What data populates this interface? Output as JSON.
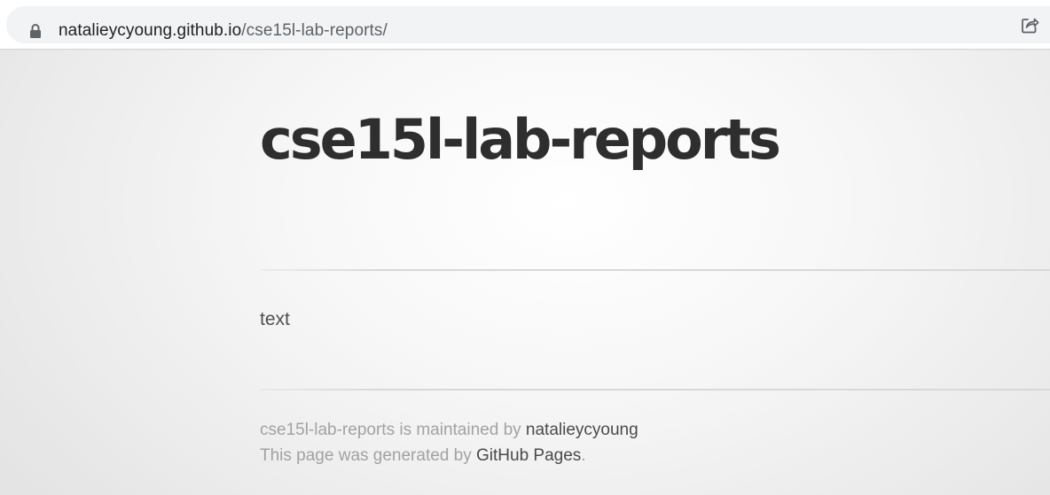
{
  "browser": {
    "url_domain": "natalieycyoung.github.io",
    "url_path": "/cse15l-lab-reports/",
    "lock_icon": "lock-icon",
    "share_icon": "share-icon"
  },
  "header": {
    "title": "cse15l-lab-reports"
  },
  "main": {
    "text": "text"
  },
  "footer": {
    "line1_prefix": "cse15l-lab-reports is maintained by ",
    "owner_link": "natalieycyoung",
    "line2_prefix": "This page was generated by ",
    "pages_link": "GitHub Pages",
    "line2_suffix": "."
  }
}
